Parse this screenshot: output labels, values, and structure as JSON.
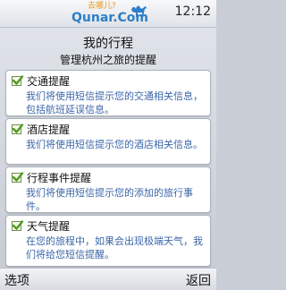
{
  "status_bar": {
    "logo_tagline": "去哪儿?",
    "logo_brand": "Qunar.Com",
    "time": "12:12"
  },
  "header": {
    "title": "我的行程",
    "subtitle": "管理杭州之旅的提醒"
  },
  "reminders": [
    {
      "title": "交通提醒",
      "description": "我们将使用短信提示您的交通相关信息，包括航班延误信息。",
      "checked": true
    },
    {
      "title": "酒店提醒",
      "description": "我们将使用短信提示您的酒店相关信息。",
      "checked": true
    },
    {
      "title": "行程事件提醒",
      "description": "我们将使用短信提示您的添加的旅行事件。",
      "checked": true
    },
    {
      "title": "天气提醒",
      "description": "在您的旅程中，如果会出现极端天气，我们将给您短信提醒。",
      "checked": true
    }
  ],
  "softkeys": {
    "left": "选项",
    "right": "返回"
  },
  "colors": {
    "brand_blue": "#2d7fc7",
    "brand_orange": "#e79a17",
    "check_green": "#4f9a1e",
    "description_blue": "#3b66a8"
  }
}
